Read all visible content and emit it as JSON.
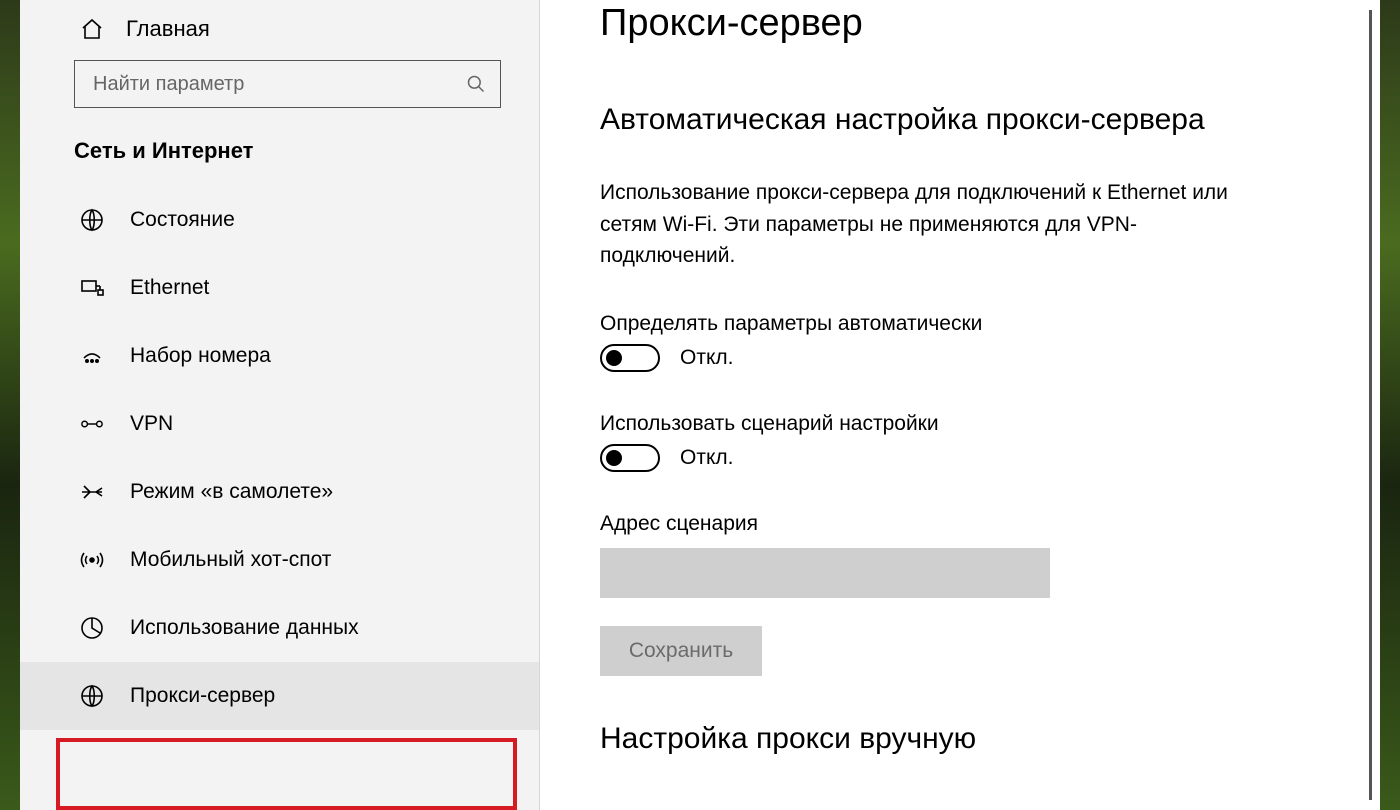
{
  "sidebar": {
    "home_label": "Главная",
    "search_placeholder": "Найти параметр",
    "section_title": "Сеть и Интернет",
    "items": [
      {
        "label": "Состояние"
      },
      {
        "label": "Ethernet"
      },
      {
        "label": "Набор номера"
      },
      {
        "label": "VPN"
      },
      {
        "label": "Режим «в самолете»"
      },
      {
        "label": "Мобильный хот-спот"
      },
      {
        "label": "Использование данных"
      },
      {
        "label": "Прокси-сервер"
      }
    ]
  },
  "main": {
    "page_title": "Прокси-сервер",
    "auto_section_title": "Автоматическая настройка прокси-сервера",
    "description": "Использование прокси-сервера для подключений к Ethernet или сетям Wi-Fi. Эти параметры не применяются для VPN-подключений.",
    "auto_detect_label": "Определять параметры автоматически",
    "auto_detect_status": "Откл.",
    "use_script_label": "Использовать сценарий настройки",
    "use_script_status": "Откл.",
    "script_address_label": "Адрес сценария",
    "script_address_value": "",
    "save_label": "Сохранить",
    "manual_section_title": "Настройка прокси вручную"
  }
}
